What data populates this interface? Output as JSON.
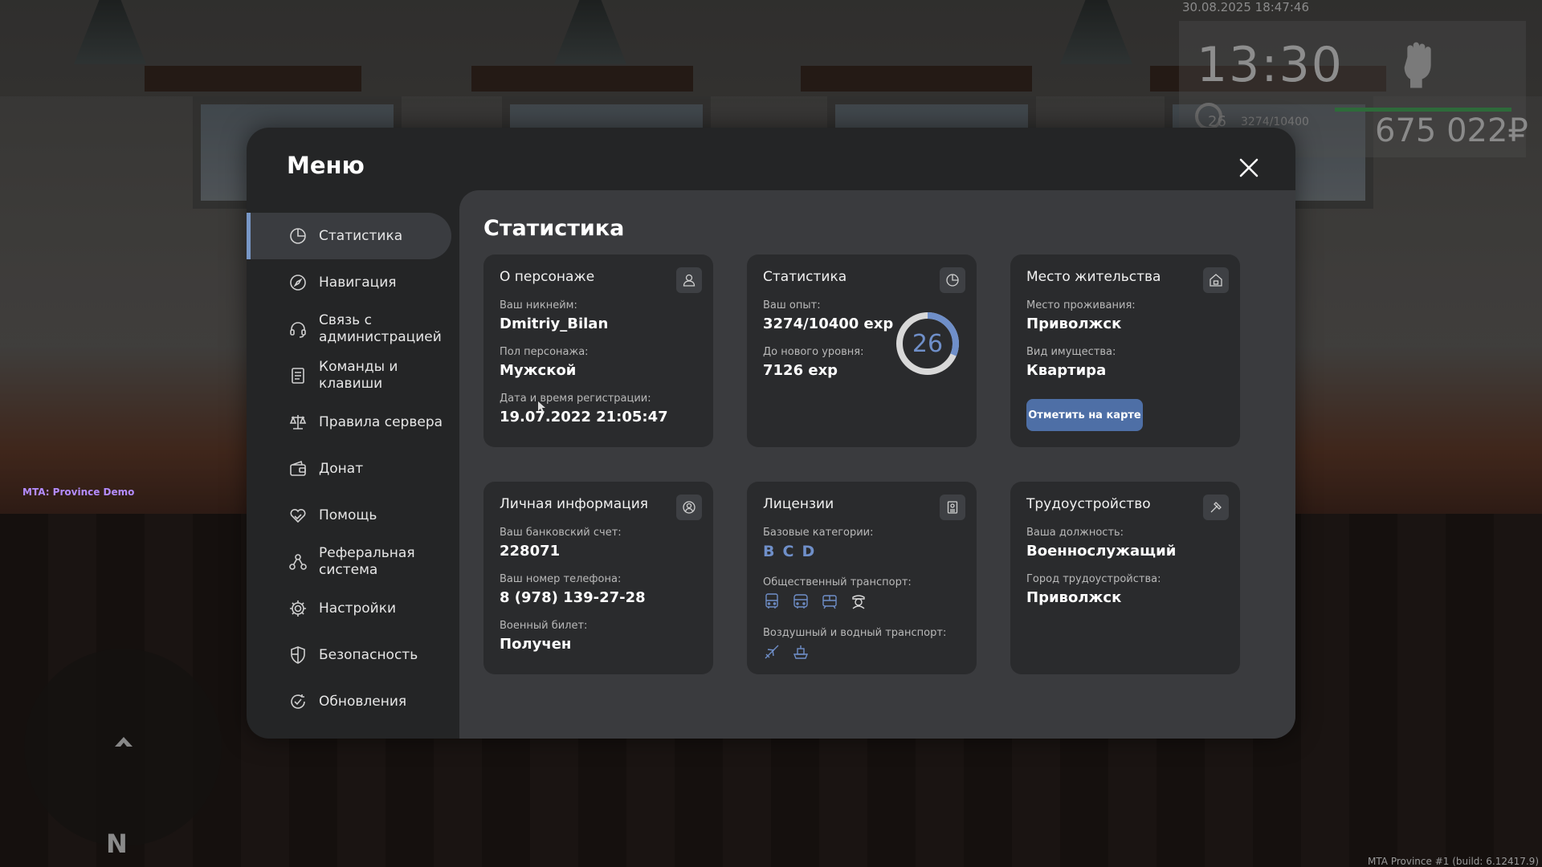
{
  "hud": {
    "datetime": "30.08.2025 18:47:46",
    "time": "13:30",
    "level": "26",
    "exp": "3274/10400",
    "money": "675 022₽",
    "server_label": "MTA: Province Demo",
    "compass": "N",
    "build": "MTA Province #1 (build: 6.12417.9)"
  },
  "menu": {
    "title": "Меню",
    "sidebar": [
      {
        "label": "Статистика",
        "icon": "pie-chart-icon",
        "active": true
      },
      {
        "label": "Навигация",
        "icon": "compass-icon"
      },
      {
        "label": "Связь с администрацией",
        "icon": "headset-icon"
      },
      {
        "label": "Команды и клавиши",
        "icon": "list-icon"
      },
      {
        "label": "Правила сервера",
        "icon": "scales-icon"
      },
      {
        "label": "Донат",
        "icon": "wallet-icon"
      },
      {
        "label": "Помощь",
        "icon": "heart-hand-icon"
      },
      {
        "label": "Реферальная система",
        "icon": "referral-icon"
      },
      {
        "label": "Настройки",
        "icon": "gear-icon"
      },
      {
        "label": "Безопасность",
        "icon": "shield-icon"
      },
      {
        "label": "Обновления",
        "icon": "refresh-check-icon"
      }
    ]
  },
  "stats": {
    "title": "Статистика",
    "character": {
      "title": "О персонаже",
      "nickname_label": "Ваш никнейм:",
      "nickname": "Dmitriy_Bilan",
      "gender_label": "Пол персонажа:",
      "gender": "Мужской",
      "reg_label": "Дата и время регистрации:",
      "reg_date": "19.07.2022 21:05:47"
    },
    "experience": {
      "title": "Статистика",
      "exp_label": "Ваш опыт:",
      "exp": "3274/10400 exp",
      "next_label": "До нового уровня:",
      "next": "7126 exp",
      "level": "26",
      "progress": 0.315
    },
    "residence": {
      "title": "Место жительства",
      "place_label": "Место проживания:",
      "place": "Приволжск",
      "property_label": "Вид имущества:",
      "property": "Квартира",
      "map_button": "Отметить на карте"
    },
    "personal": {
      "title": "Личная информация",
      "bank_label": "Ваш банковский счет:",
      "bank": "228071",
      "phone_label": "Ваш номер телефона:",
      "phone": "8 (978) 139-27-28",
      "military_label": "Военный билет:",
      "military": "Получен"
    },
    "licenses": {
      "title": "Лицензии",
      "basic_label": "Базовые категории:",
      "categories": [
        "B",
        "C",
        "D"
      ],
      "public_label": "Общественный транспорт:",
      "public_icons": [
        "bus-icon",
        "bus-icon",
        "tram-icon",
        "driver-icon"
      ],
      "air_label": "Воздушный и водный транспорт:",
      "air_icons": [
        "plane-icon",
        "ship-icon"
      ]
    },
    "employment": {
      "title": "Трудоустройство",
      "position_label": "Ваша должность:",
      "position": "Военнослужащий",
      "city_label": "Город трудоустройства:",
      "city": "Приволжск"
    }
  },
  "colors": {
    "accent": "#6f8fc9",
    "button": "#4e6fa6",
    "panel": "#242526",
    "content": "#3a3b3e",
    "card": "#2a2b2d"
  }
}
